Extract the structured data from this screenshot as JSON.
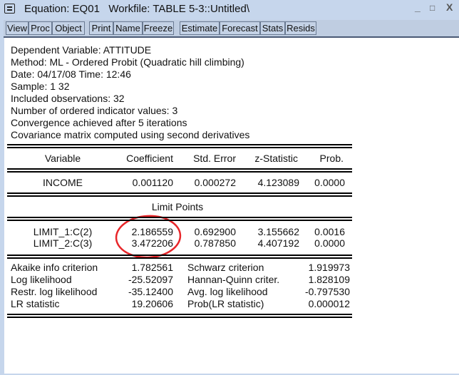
{
  "window": {
    "title": "Equation: EQ01   Workfile: TABLE 5-3::Untitled\\",
    "minimize": "_",
    "maximize": "□",
    "close": "X"
  },
  "toolbar": [
    "View",
    "Proc",
    "Object",
    "Print",
    "Name",
    "Freeze",
    "Estimate",
    "Forecast",
    "Stats",
    "Resids"
  ],
  "header_lines": [
    "Dependent Variable: ATTITUDE",
    "Method: ML - Ordered Probit (Quadratic hill climbing)",
    "Date: 04/17/08   Time: 12:46",
    "Sample: 1 32",
    "Included observations: 32",
    "Number of ordered indicator values: 3",
    "Convergence achieved after 5 iterations",
    "Covariance matrix computed using second derivatives"
  ],
  "columns": [
    "Variable",
    "Coefficient",
    "Std. Error",
    "z-Statistic",
    "Prob."
  ],
  "coef_rows": [
    [
      "INCOME",
      "0.001120",
      "0.000272",
      "4.123089",
      "0.0000"
    ]
  ],
  "limit_title": "Limit Points",
  "limit_rows": [
    [
      "LIMIT_1:C(2)",
      "2.186559",
      "0.692900",
      "3.155662",
      "0.0016"
    ],
    [
      "LIMIT_2:C(3)",
      "3.472206",
      "0.787850",
      "4.407192",
      "0.0000"
    ]
  ],
  "stats": [
    [
      "Akaike info criterion",
      "1.782561",
      "Schwarz criterion",
      "1.919973"
    ],
    [
      "Log likelihood",
      "-25.52097",
      "Hannan-Quinn criter.",
      "1.828109"
    ],
    [
      "Restr. log likelihood",
      "-35.12400",
      "Avg. log likelihood",
      "-0.797530"
    ],
    [
      "LR statistic",
      "19.20606",
      "Prob(LR statistic)",
      "0.000012"
    ]
  ],
  "annotation_color": "#e8262a"
}
